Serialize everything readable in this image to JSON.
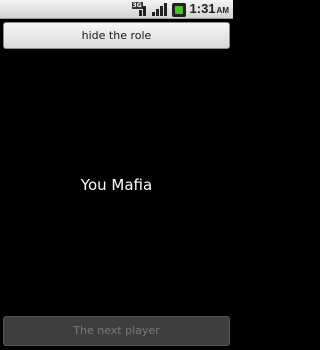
{
  "status_bar": {
    "network_badge": "3G",
    "time": "1:31",
    "ampm": "AM",
    "icons": [
      "network-3g-icon",
      "signal-icon",
      "battery-icon"
    ],
    "battery_color": "#4cc12a"
  },
  "actions": {
    "hide_role_label": "hide the role",
    "next_player_label": "The next player"
  },
  "role": {
    "text": "You Mafia"
  }
}
